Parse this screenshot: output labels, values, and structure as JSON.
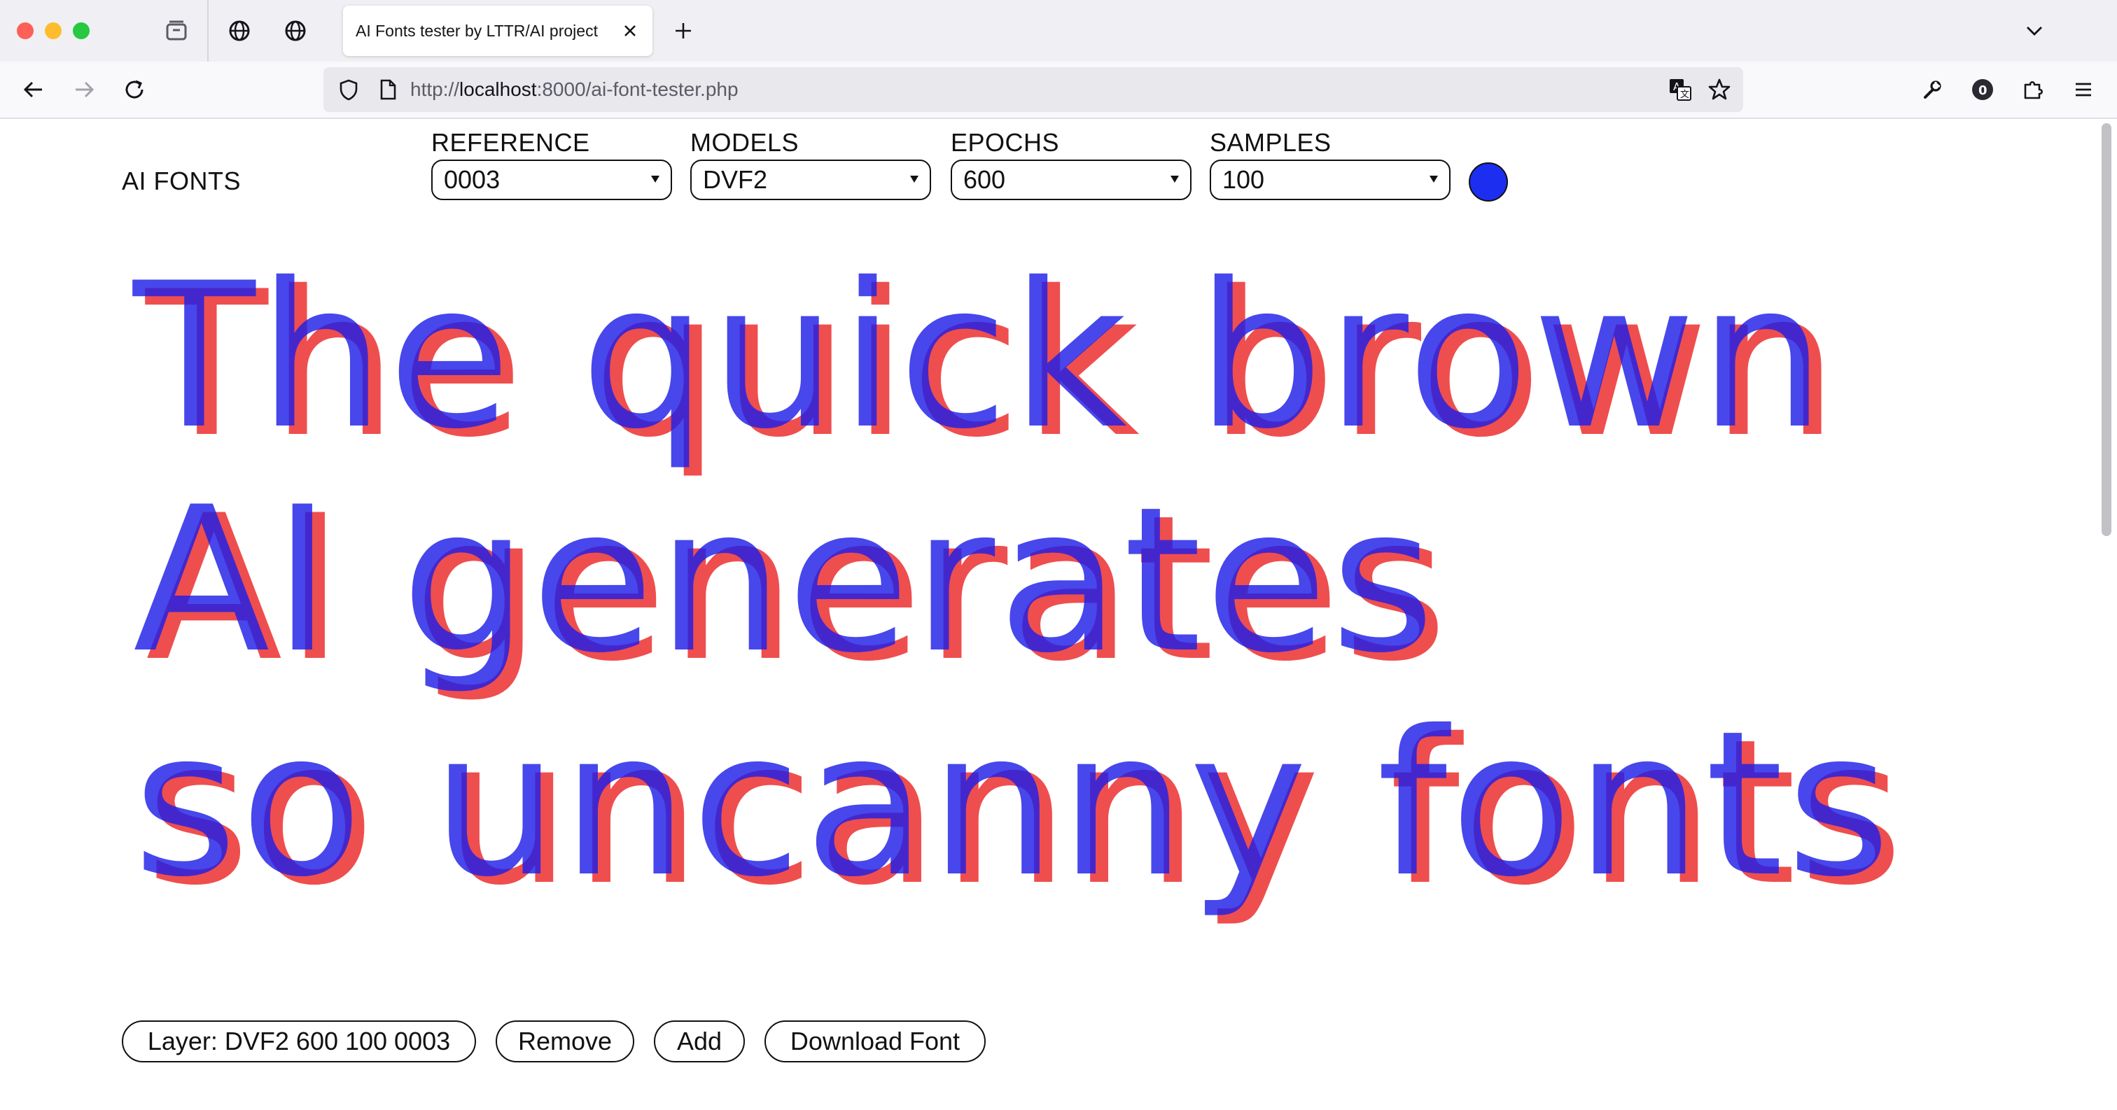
{
  "browser": {
    "tab_title": "AI Fonts tester by LTTR/AI project",
    "url_prefix": "http://",
    "url_host": "localhost",
    "url_rest": ":8000/ai-font-tester.php"
  },
  "page": {
    "logo": "AI FONTS",
    "controls": [
      {
        "label": "REFERENCE",
        "value": "0003"
      },
      {
        "label": "MODELS",
        "value": "DVF2"
      },
      {
        "label": "EPOCHS",
        "value": "600"
      },
      {
        "label": "SAMPLES",
        "value": "100"
      }
    ],
    "color_swatch": "#1c2ff0",
    "specimen_lines": [
      "The quick brown",
      "AI generates",
      "so uncanny fonts"
    ],
    "layer_colors": {
      "top": "#1f1fe8",
      "bottom": "#ee3b3b"
    },
    "buttons": {
      "layer": "Layer: DVF2 600 100 0003",
      "remove": "Remove",
      "add": "Add",
      "download": "Download Font"
    }
  }
}
